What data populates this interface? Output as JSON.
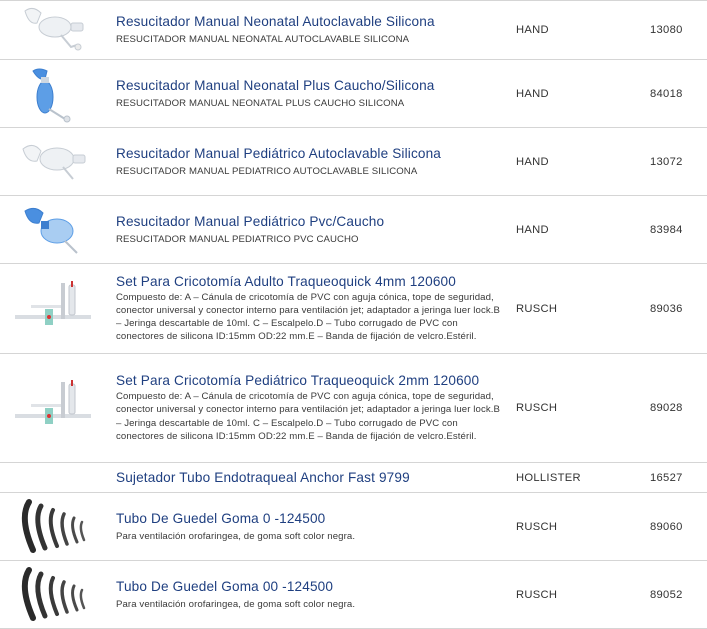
{
  "products": [
    {
      "title": "Resucitador Manual Neonatal Autoclavable Silicona",
      "subtitle": "RESUCITADOR MANUAL NEONATAL AUTOCLAVABLE SILICONA",
      "brand": "HAND",
      "code": "13080",
      "icon": "resuscitator-clear-icon"
    },
    {
      "title": "Resucitador Manual Neonatal Plus Caucho/Silicona",
      "subtitle": "RESUCITADOR MANUAL NEONATAL PLUS CAUCHO SILICONA",
      "brand": "HAND",
      "code": "84018",
      "icon": "resuscitator-blue-icon"
    },
    {
      "title": "Resucitador Manual Pediátrico Autoclavable Silicona",
      "subtitle": "RESUCITADOR MANUAL PEDIATRICO AUTOCLAVABLE SILICONA",
      "brand": "HAND",
      "code": "13072",
      "icon": "resuscitator-clear-icon"
    },
    {
      "title": "Resucitador Manual Pediátrico Pvc/Caucho",
      "subtitle": "RESUCITADOR MANUAL PEDIATRICO PVC CAUCHO",
      "brand": "HAND",
      "code": "83984",
      "icon": "resuscitator-blue-icon"
    },
    {
      "title": "Set Para Cricotomía Adulto Traqueoquick 4mm 120600",
      "subtitle": "Compuesto de: A – Cánula de cricotomía de PVC con aguja cónica, tope de seguridad, conector universal y conector interno para ventilación jet; adaptador a jeringa luer lock.B – Jeringa descartable de 10ml. C – Escalpelo.D – Tubo corrugado de PVC con conectores de silicona ID:15mm OD:22 mm.E – Banda de fijación de velcro.Estéril.",
      "brand": "RUSCH",
      "code": "89036",
      "icon": "cricothyrotomy-set-icon"
    },
    {
      "title": "Set Para Cricotomía Pediátrico Traqueoquick 2mm 120600",
      "subtitle": "Compuesto de: A – Cánula de cricotomía de PVC con aguja cónica, tope de seguridad, conector universal y conector interno para ventilación jet; adaptador a jeringa luer lock.B – Jeringa descartable de 10ml. C – Escalpelo.D – Tubo corrugado de PVC con conectores de silicona ID:15mm OD:22 mm.E – Banda de fijación de velcro.Estéril.",
      "brand": "RUSCH",
      "code": "89028",
      "icon": "cricothyrotomy-set-icon"
    },
    {
      "title": "Sujetador Tubo Endotraqueal Anchor Fast 9799",
      "subtitle": "",
      "brand": "HOLLISTER",
      "code": "16527",
      "icon": ""
    },
    {
      "title": "Tubo De Guedel Goma 0 -124500",
      "subtitle": "Para ventilación orofaringea, de goma soft color negra.",
      "brand": "RUSCH",
      "code": "89060",
      "icon": "guedel-airway-icon"
    },
    {
      "title": "Tubo De Guedel Goma 00 -124500",
      "subtitle": "Para ventilación orofaringea, de goma soft color negra.",
      "brand": "RUSCH",
      "code": "89052",
      "icon": "guedel-airway-icon"
    }
  ]
}
